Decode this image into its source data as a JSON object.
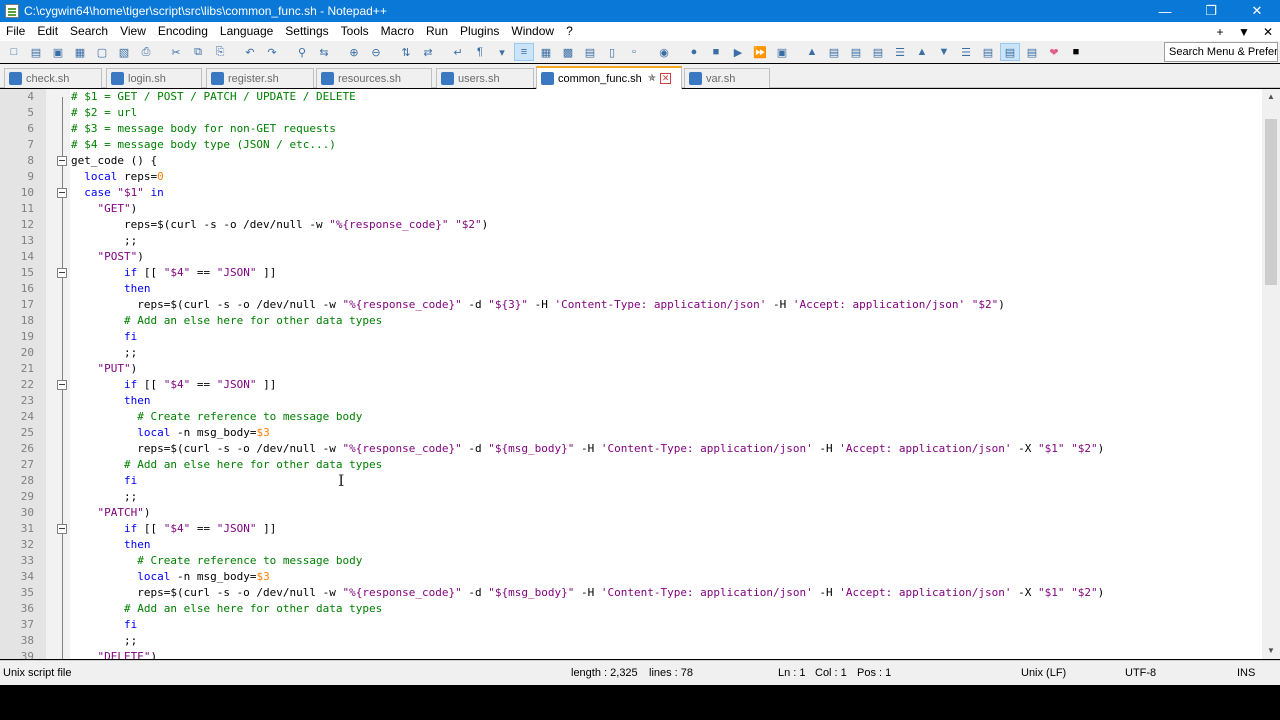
{
  "window": {
    "title": "C:\\cygwin64\\home\\tiger\\script\\src\\libs\\common_func.sh - Notepad++",
    "minimize_icon": "minimize-icon",
    "maximize_icon": "maximize-icon",
    "close_icon": "close-icon",
    "title_color": "#0a78d7"
  },
  "menu": {
    "items": [
      "File",
      "Edit",
      "Search",
      "View",
      "Encoding",
      "Language",
      "Settings",
      "Tools",
      "Macro",
      "Run",
      "Plugins",
      "Window",
      "?"
    ],
    "right": [
      "+",
      "▼",
      "✕"
    ]
  },
  "toolbar": {
    "search_placeholder": "Search Menu & Preferences"
  },
  "tabs": [
    {
      "label": "check.sh",
      "active": false
    },
    {
      "label": "login.sh",
      "active": false
    },
    {
      "label": "register.sh",
      "active": false
    },
    {
      "label": "resources.sh",
      "active": false
    },
    {
      "label": "users.sh",
      "active": false
    },
    {
      "label": "common_func.sh",
      "active": true
    },
    {
      "label": "var.sh",
      "active": false
    }
  ],
  "editor": {
    "lines": [
      {
        "n": "4",
        "t": "# $1 = GET / POST / PATCH / UPDATE / DELETE"
      },
      {
        "n": "5",
        "t": "# $2 = url"
      },
      {
        "n": "6",
        "t": "# $3 = message body for non-GET requests"
      },
      {
        "n": "7",
        "t": "# $4 = message body type (JSON / etc...)"
      },
      {
        "n": "8",
        "t": "get_code () {"
      },
      {
        "n": "9",
        "t": "  local reps=0"
      },
      {
        "n": "10",
        "t": "  case \"$1\" in"
      },
      {
        "n": "11",
        "t": "    \"GET\")"
      },
      {
        "n": "12",
        "t": "        reps=$(curl -s -o /dev/null -w \"%{response_code}\" \"$2\")"
      },
      {
        "n": "13",
        "t": "        ;;"
      },
      {
        "n": "14",
        "t": "    \"POST\")"
      },
      {
        "n": "15",
        "t": "        if [[ \"$4\" == \"JSON\" ]]"
      },
      {
        "n": "16",
        "t": "        then"
      },
      {
        "n": "17",
        "t": "          reps=$(curl -s -o /dev/null -w \"%{response_code}\" -d \"${3}\" -H 'Content-Type: application/json' -H 'Accept: application/json' \"$2\")"
      },
      {
        "n": "18",
        "t": "        # Add an else here for other data types"
      },
      {
        "n": "19",
        "t": "        fi"
      },
      {
        "n": "20",
        "t": "        ;;"
      },
      {
        "n": "21",
        "t": "    \"PUT\")"
      },
      {
        "n": "22",
        "t": "        if [[ \"$4\" == \"JSON\" ]]"
      },
      {
        "n": "23",
        "t": "        then"
      },
      {
        "n": "24",
        "t": "          # Create reference to message body"
      },
      {
        "n": "25",
        "t": "          local -n msg_body=$3"
      },
      {
        "n": "26",
        "t": "          reps=$(curl -s -o /dev/null -w \"%{response_code}\" -d \"${msg_body}\" -H 'Content-Type: application/json' -H 'Accept: application/json' -X \"$1\" \"$2\")"
      },
      {
        "n": "27",
        "t": "        # Add an else here for other data types"
      },
      {
        "n": "28",
        "t": "        fi"
      },
      {
        "n": "29",
        "t": "        ;;"
      },
      {
        "n": "30",
        "t": "    \"PATCH\")"
      },
      {
        "n": "31",
        "t": "        if [[ \"$4\" == \"JSON\" ]]"
      },
      {
        "n": "32",
        "t": "        then"
      },
      {
        "n": "33",
        "t": "          # Create reference to message body"
      },
      {
        "n": "34",
        "t": "          local -n msg_body=$3"
      },
      {
        "n": "35",
        "t": "          reps=$(curl -s -o /dev/null -w \"%{response_code}\" -d \"${msg_body}\" -H 'Content-Type: application/json' -H 'Accept: application/json' -X \"$1\" \"$2\")"
      },
      {
        "n": "36",
        "t": "        # Add an else here for other data types"
      },
      {
        "n": "37",
        "t": "        fi"
      },
      {
        "n": "38",
        "t": "        ;;"
      },
      {
        "n": "39",
        "t": "    \"DELETE\")"
      }
    ]
  },
  "status": {
    "file_type": "Unix script file",
    "length": "length : 2,325",
    "lines": "lines : 78",
    "ln": "Ln : 1",
    "col": "Col : 1",
    "pos": "Pos : 1",
    "eol": "Unix (LF)",
    "encoding": "UTF-8",
    "mode": "INS"
  }
}
